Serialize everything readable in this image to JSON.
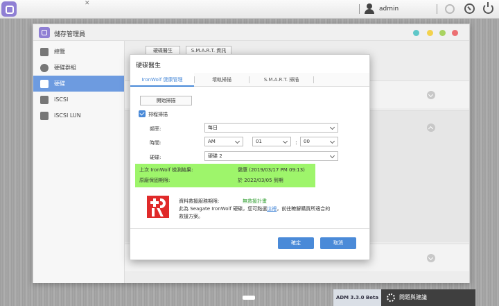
{
  "topbar": {
    "close_glyph": "✕",
    "username": "admin"
  },
  "window": {
    "title": "儲存管理員"
  },
  "sidebar": {
    "items": [
      {
        "label": "總覽"
      },
      {
        "label": "硬碟群組"
      },
      {
        "label": "硬碟"
      },
      {
        "label": "iSCSI"
      },
      {
        "label": "iSCSI LUN"
      }
    ]
  },
  "content": {
    "tabs": [
      {
        "label": "硬碟醫生"
      },
      {
        "label": "S.M.A.R.T. 資訊"
      }
    ]
  },
  "modal": {
    "title": "硬碟醫生",
    "tabs": [
      {
        "label": "IronWolf 健康管理"
      },
      {
        "label": "壞軌掃描"
      },
      {
        "label": "S.M.A.R.T. 掃描"
      }
    ],
    "start_scan_label": "開始掃描",
    "schedule_label": "排程掃描",
    "frequency_label": "頻率:",
    "frequency_value": "每日",
    "time_label": "時間:",
    "ampm_value": "AM",
    "hour_value": "01",
    "minute_value": "00",
    "time_colon": ":",
    "disk_label": "硬碟:",
    "disk_value": "硬碟 2",
    "last_result_label": "上次 IronWolf 檢測結果:",
    "last_result_value": "健康 (2019/03/17 PM 09:13)",
    "warranty_label": "原廠保固期限:",
    "warranty_value": "於 2022/03/05 到期",
    "rescue_label": "資料救援服務期限:",
    "rescue_value": "無救援計畫",
    "info_line1_prefix": "此為 Seagate IronWolf 硬碟，您可點選",
    "info_link": "這裡",
    "info_line1_suffix": "，前往瞭解購買所適合的",
    "info_line2": "救援方案。",
    "ok_label": "確定",
    "cancel_label": "取消"
  },
  "bottombar": {
    "version": "ADM 3.3.0 Beta",
    "help_label": "問題與建議"
  },
  "colors": {
    "accent": "#4a8ad8",
    "highlight": "#9ef56b",
    "sidebar_active": "#6d9be0",
    "logo_red": "#e02a2a"
  }
}
